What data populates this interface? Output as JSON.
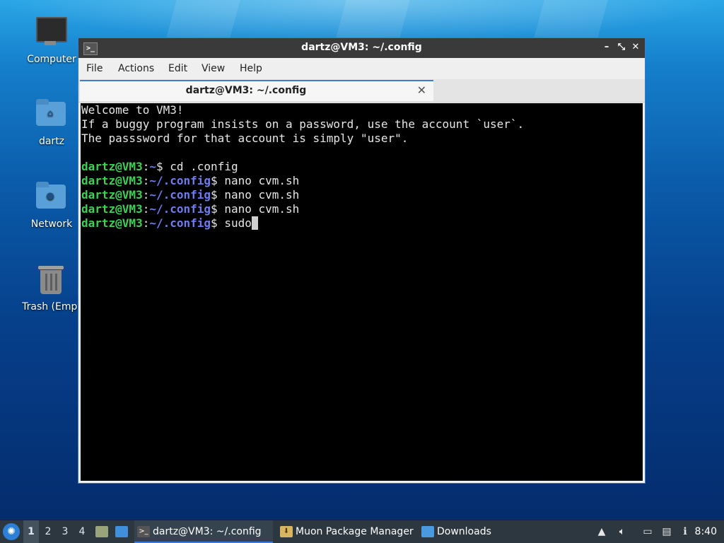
{
  "desktop": {
    "icons": [
      {
        "label": "Computer"
      },
      {
        "label": "dartz"
      },
      {
        "label": "Network"
      },
      {
        "label": "Trash (Empt"
      }
    ]
  },
  "window": {
    "title": "dartz@VM3: ~/.config",
    "app_icon_glyph": ">_",
    "controls": {
      "minimize": "–",
      "restore": "⤡",
      "close": "✕"
    },
    "menu": [
      "File",
      "Actions",
      "Edit",
      "View",
      "Help"
    ],
    "tab": {
      "label": "dartz@VM3: ~/.config",
      "close": "✕"
    }
  },
  "terminal": {
    "welcome": [
      "Welcome to VM3!",
      "If a buggy program insists on a password, use the account `user`.",
      "The passsword for that account is simply \"user\"."
    ],
    "prompts": [
      {
        "user": "dartz@VM3",
        "sep": ":",
        "path": "~",
        "symbol": "$",
        "command": " cd .config"
      },
      {
        "user": "dartz@VM3",
        "sep": ":",
        "path": "~/.config",
        "symbol": "$",
        "command": " nano cvm.sh"
      },
      {
        "user": "dartz@VM3",
        "sep": ":",
        "path": "~/.config",
        "symbol": "$",
        "command": " nano cvm.sh"
      },
      {
        "user": "dartz@VM3",
        "sep": ":",
        "path": "~/.config",
        "symbol": "$",
        "command": " nano cvm.sh"
      },
      {
        "user": "dartz@VM3",
        "sep": ":",
        "path": "~/.config",
        "symbol": "$",
        "command": " sudo"
      }
    ]
  },
  "taskbar": {
    "workspaces": [
      "1",
      "2",
      "3",
      "4"
    ],
    "tasks": [
      {
        "label": "dartz@VM3: ~/.config",
        "icon": "terminal-icon"
      },
      {
        "label": "Muon Package Manager",
        "icon": "package-manager-icon"
      },
      {
        "label": "Downloads",
        "icon": "folder-icon"
      }
    ],
    "clock": "8:40"
  }
}
